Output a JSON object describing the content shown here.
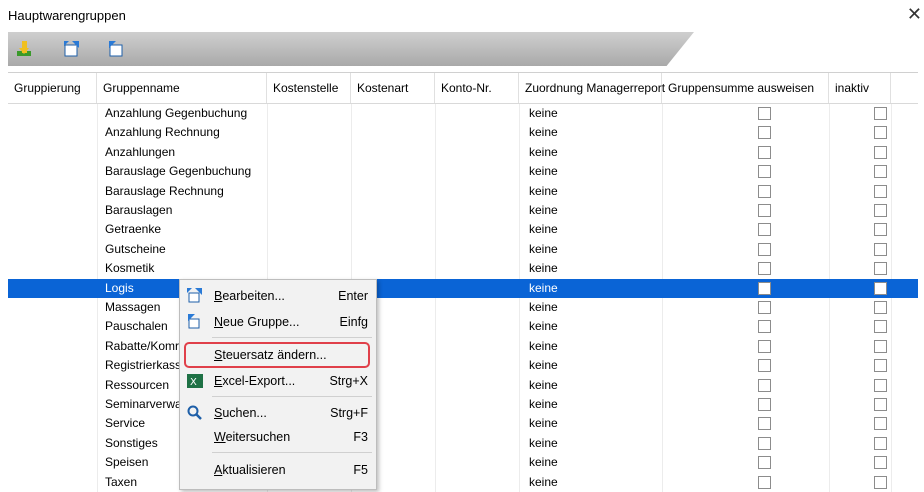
{
  "window": {
    "title": "Hauptwarengruppen",
    "close": "✕"
  },
  "toolbar": {
    "buttons": [
      "exit-icon",
      "edit-icon",
      "new-group-icon"
    ]
  },
  "columns": [
    "Gruppierung",
    "Gruppenname",
    "Kostenstelle",
    "Kostenart",
    "Konto-Nr.",
    "Zuordnung Managerreport",
    "Gruppensumme ausweisen",
    "inaktiv"
  ],
  "rows": [
    {
      "name": "Anzahlung Gegenbuchung",
      "report": "keine"
    },
    {
      "name": "Anzahlung Rechnung",
      "report": "keine"
    },
    {
      "name": "Anzahlungen",
      "report": "keine"
    },
    {
      "name": "Barauslage Gegenbuchung",
      "report": "keine"
    },
    {
      "name": "Barauslage Rechnung",
      "report": "keine"
    },
    {
      "name": "Barauslagen",
      "report": "keine"
    },
    {
      "name": "Getraenke",
      "report": "keine"
    },
    {
      "name": "Gutscheine",
      "report": "keine"
    },
    {
      "name": "Kosmetik",
      "report": "keine"
    },
    {
      "name": "Logis",
      "report": "keine",
      "selected": true
    },
    {
      "name": "Massagen",
      "report": "keine"
    },
    {
      "name": "Pauschalen",
      "report": "keine"
    },
    {
      "name": "Rabatte/Komr",
      "report": "keine"
    },
    {
      "name": "Registrierkass",
      "report": "keine"
    },
    {
      "name": "Ressourcen",
      "report": "keine"
    },
    {
      "name": "Seminarverwa",
      "report": "keine"
    },
    {
      "name": "Service",
      "report": "keine"
    },
    {
      "name": "Sonstiges",
      "report": "keine"
    },
    {
      "name": "Speisen",
      "report": "keine"
    },
    {
      "name": "Taxen",
      "report": "keine"
    }
  ],
  "context_menu": {
    "items": [
      {
        "label": "Bearbeiten...",
        "underline": "B",
        "shortcut": "Enter",
        "icon": "edit-icon"
      },
      {
        "label": "Neue Gruppe...",
        "underline": "N",
        "shortcut": "Einfg",
        "icon": "new-group-icon"
      },
      {
        "label": "Steuersatz ändern...",
        "underline": "S",
        "shortcut": "",
        "icon": "",
        "highlighted": true
      },
      {
        "label": "Excel-Export...",
        "underline": "E",
        "shortcut": "Strg+X",
        "icon": "excel-icon"
      },
      {
        "label": "Suchen...",
        "underline": "S",
        "shortcut": "Strg+F",
        "icon": "search-icon"
      },
      {
        "label": "Weitersuchen",
        "underline": "W",
        "shortcut": "F3",
        "icon": ""
      },
      {
        "label": "Aktualisieren",
        "underline": "A",
        "shortcut": "F5",
        "icon": ""
      }
    ]
  },
  "colors": {
    "selection": "#0a64d6",
    "highlight_border": "#e0404a"
  }
}
